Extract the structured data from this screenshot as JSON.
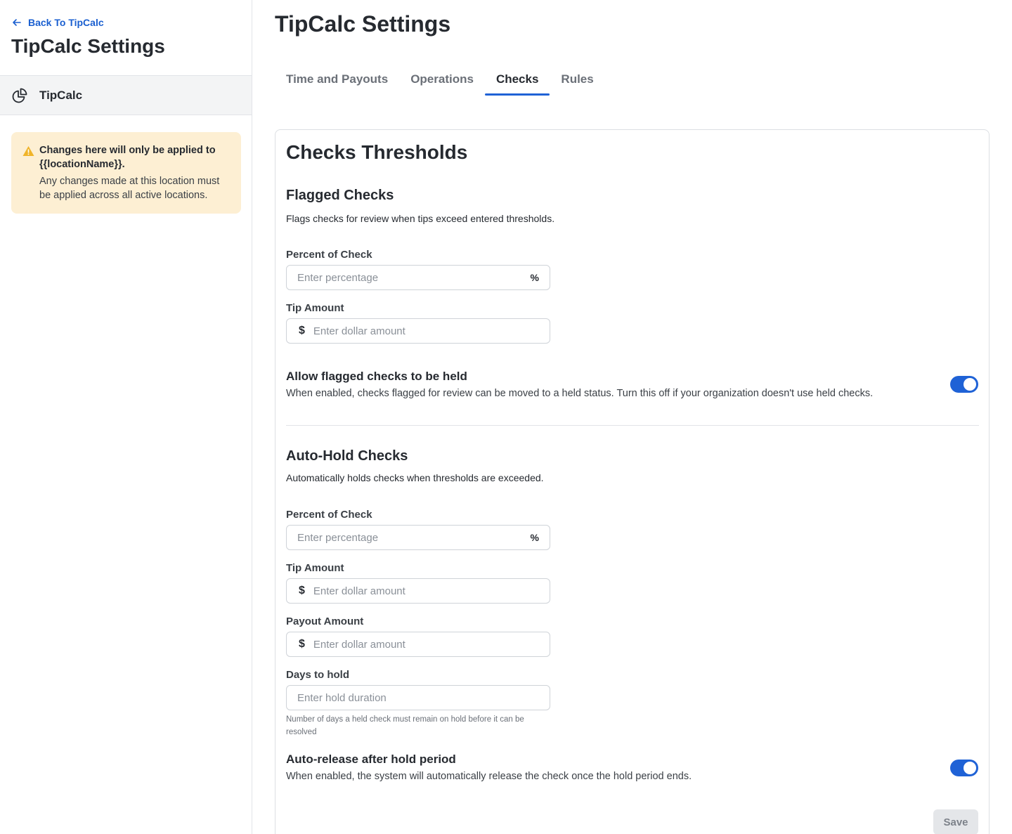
{
  "sidebar": {
    "back_label": "Back To TipCalc",
    "title": "TipCalc Settings",
    "nav_item_label": "TipCalc",
    "notice": {
      "title": "Changes here will only be applied to {{locationName}}.",
      "body": "Any changes made at this location must be applied across all active locations."
    }
  },
  "main": {
    "title": "TipCalc Settings",
    "tabs": [
      {
        "label": "Time and Payouts"
      },
      {
        "label": "Operations"
      },
      {
        "label": "Checks"
      },
      {
        "label": "Rules"
      }
    ],
    "active_tab": "Checks"
  },
  "card": {
    "title": "Checks Thresholds",
    "flagged": {
      "title": "Flagged Checks",
      "desc": "Flags checks for review when tips exceed entered thresholds.",
      "percent_label": "Percent of Check",
      "percent_placeholder": "Enter percentage",
      "percent_suffix": "%",
      "tip_label": "Tip Amount",
      "tip_prefix": "$",
      "tip_placeholder": "Enter dollar amount",
      "toggle_title": "Allow flagged checks to be held",
      "toggle_desc": "When enabled, checks flagged for review can be moved to a held status. Turn this off if your organization doesn't use held checks.",
      "toggle_on": true
    },
    "autohold": {
      "title": "Auto-Hold Checks",
      "desc": "Automatically holds checks when thresholds are exceeded.",
      "percent_label": "Percent of Check",
      "percent_placeholder": "Enter percentage",
      "percent_suffix": "%",
      "tip_label": "Tip Amount",
      "tip_prefix": "$",
      "tip_placeholder": "Enter dollar amount",
      "payout_label": "Payout Amount",
      "payout_prefix": "$",
      "payout_placeholder": "Enter dollar amount",
      "days_label": "Days to hold",
      "days_placeholder": "Enter hold duration",
      "days_helper": "Number of days a held check must remain on hold before it can be resolved",
      "toggle_title": "Auto-release after hold period",
      "toggle_desc": "When enabled, the system will automatically release the check once the hold period ends.",
      "toggle_on": true
    },
    "save_label": "Save"
  },
  "colors": {
    "accent": "#1f62d6",
    "link": "#1a5fd0",
    "notice_bg": "#fdefd3",
    "warning_icon": "#f0b429"
  },
  "icons": {
    "back": "arrow-left-icon",
    "nav": "pie-chart-icon",
    "notice": "warning-triangle-icon"
  }
}
